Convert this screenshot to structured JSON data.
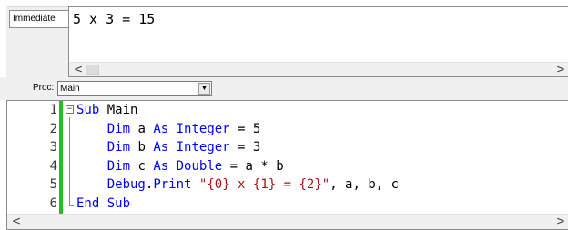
{
  "immediate": {
    "tab_label": "Immediate",
    "output": "5 x 3 = 15",
    "scroll_left": "<",
    "scroll_right": ">"
  },
  "proc": {
    "label": "Proc:",
    "selected": "Main",
    "dropdown_glyph": "▼"
  },
  "editor": {
    "fold_glyph": "−",
    "scroll_left": "<",
    "scroll_right": ">",
    "lines": [
      {
        "num": "1",
        "tokens": [
          {
            "t": "Sub",
            "c": "kw"
          },
          {
            "t": " Main",
            "c": ""
          }
        ]
      },
      {
        "num": "2",
        "tokens": [
          {
            "t": "    ",
            "c": ""
          },
          {
            "t": "Dim",
            "c": "kw"
          },
          {
            "t": " a ",
            "c": ""
          },
          {
            "t": "As",
            "c": "kw"
          },
          {
            "t": " ",
            "c": ""
          },
          {
            "t": "Integer",
            "c": "kw"
          },
          {
            "t": " = 5",
            "c": ""
          }
        ]
      },
      {
        "num": "3",
        "tokens": [
          {
            "t": "    ",
            "c": ""
          },
          {
            "t": "Dim",
            "c": "kw"
          },
          {
            "t": " b ",
            "c": ""
          },
          {
            "t": "As",
            "c": "kw"
          },
          {
            "t": " ",
            "c": ""
          },
          {
            "t": "Integer",
            "c": "kw"
          },
          {
            "t": " = 3",
            "c": ""
          }
        ]
      },
      {
        "num": "4",
        "tokens": [
          {
            "t": "    ",
            "c": ""
          },
          {
            "t": "Dim",
            "c": "kw"
          },
          {
            "t": " c ",
            "c": ""
          },
          {
            "t": "As",
            "c": "kw"
          },
          {
            "t": " ",
            "c": ""
          },
          {
            "t": "Double",
            "c": "kw"
          },
          {
            "t": " = a * b",
            "c": ""
          }
        ]
      },
      {
        "num": "5",
        "tokens": [
          {
            "t": "    ",
            "c": ""
          },
          {
            "t": "Debug",
            "c": "kw"
          },
          {
            "t": ".",
            "c": ""
          },
          {
            "t": "Print",
            "c": "kw"
          },
          {
            "t": " ",
            "c": ""
          },
          {
            "t": "\"{0} x {1} = {2}\"",
            "c": "str"
          },
          {
            "t": ", a, b, c",
            "c": ""
          }
        ]
      },
      {
        "num": "6",
        "tokens": [
          {
            "t": "End Sub",
            "c": "kw"
          }
        ]
      }
    ]
  },
  "colors": {
    "keyword": "#0000ff",
    "string": "#a31515",
    "gutter_marker": "#22c122"
  }
}
